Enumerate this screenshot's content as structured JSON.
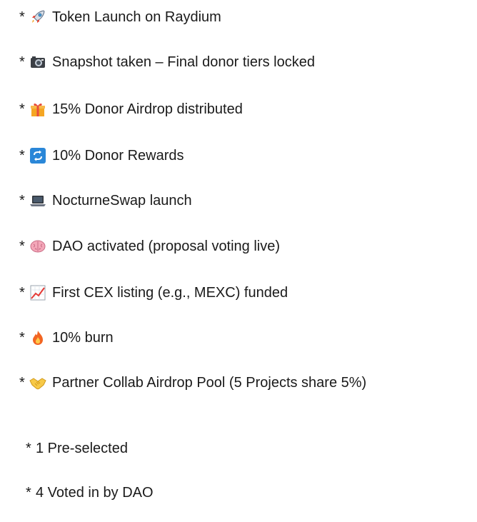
{
  "items": [
    {
      "bullet": "*",
      "icon": "rocket-icon",
      "text": "Token Launch on Raydium"
    },
    {
      "bullet": "*",
      "icon": "camera-icon",
      "text": "Snapshot taken – Final donor tiers locked"
    },
    {
      "bullet": "*",
      "icon": "gift-icon",
      "text": "15% Donor Airdrop distributed"
    },
    {
      "bullet": "*",
      "icon": "repeat-icon",
      "text": "10%  Donor Rewards"
    },
    {
      "bullet": "*",
      "icon": "laptop-icon",
      "text": "NocturneSwap launch"
    },
    {
      "bullet": "*",
      "icon": "brain-icon",
      "text": "DAO activated (proposal voting live)"
    },
    {
      "bullet": "*",
      "icon": "chart-increasing-icon",
      "text": "First CEX listing (e.g., MEXC) funded"
    },
    {
      "bullet": "*",
      "icon": "fire-icon",
      "text": "10% burn"
    },
    {
      "bullet": "*",
      "icon": "handshake-icon",
      "text": "Partner Collab Airdrop Pool (5 Projects share 5%)"
    }
  ],
  "subitems": [
    {
      "bullet": "*",
      "text": "1 Pre-selected"
    },
    {
      "bullet": "*",
      "text": "4 Voted in by DAO"
    }
  ],
  "colors": {
    "text": "#1a1a1a",
    "gift": "#f5a623",
    "repeat_bg": "#2a87d8",
    "fire": "#f26522",
    "brain": "#f4a7b9",
    "handshake": "#f7c948"
  }
}
